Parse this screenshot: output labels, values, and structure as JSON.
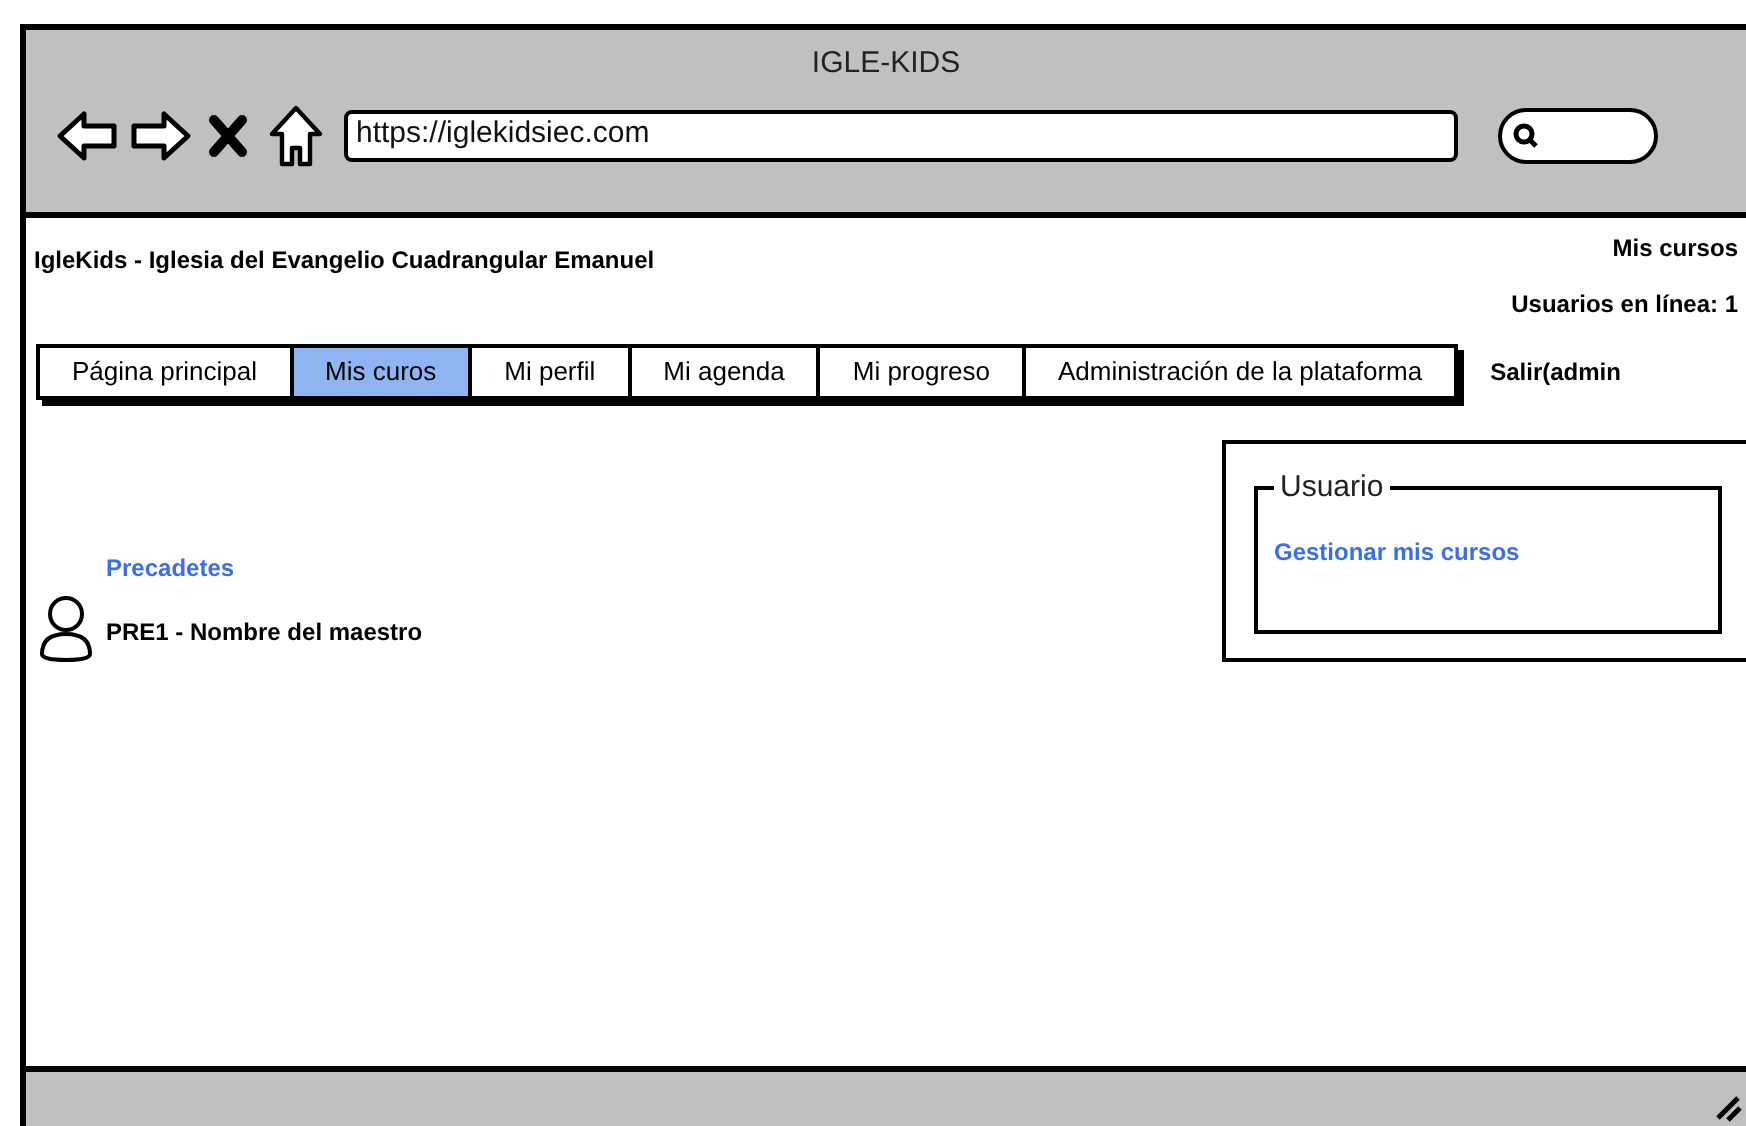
{
  "window": {
    "title": "IGLE-KIDS"
  },
  "address_bar": {
    "value": "https://iglekidsiec.com"
  },
  "header": {
    "site_name": "IgleKids - Iglesia del Evangelio Cuadrangular Emanuel",
    "top_link": "Mis cursos",
    "online_users": "Usuarios en línea: 1"
  },
  "tabs": [
    {
      "label": "Página principal",
      "selected": false
    },
    {
      "label": "Mis curos",
      "selected": true
    },
    {
      "label": "Mi perfil",
      "selected": false
    },
    {
      "label": "Mi agenda",
      "selected": false
    },
    {
      "label": "Mi progreso",
      "selected": false
    },
    {
      "label": "Administración de la plataforma",
      "selected": false
    }
  ],
  "logout": "Salir(admin",
  "course": {
    "category": "Precadetes",
    "name": "PRE1 - Nombre del maestro"
  },
  "user_panel": {
    "title": "Usuario",
    "links": [
      "Gestionar mis cursos"
    ]
  }
}
